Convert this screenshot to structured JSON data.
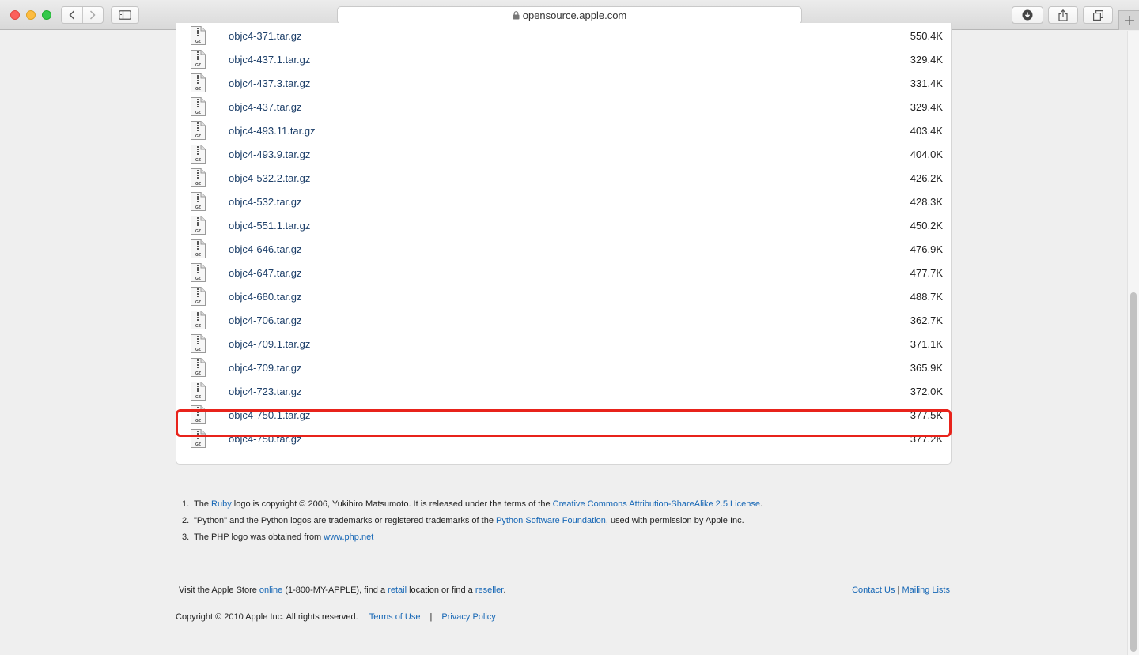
{
  "browser": {
    "url": "opensource.apple.com"
  },
  "files": [
    {
      "name": "objc4-371.tar.gz",
      "size": "550.4K"
    },
    {
      "name": "objc4-437.1.tar.gz",
      "size": "329.4K"
    },
    {
      "name": "objc4-437.3.tar.gz",
      "size": "331.4K"
    },
    {
      "name": "objc4-437.tar.gz",
      "size": "329.4K"
    },
    {
      "name": "objc4-493.11.tar.gz",
      "size": "403.4K"
    },
    {
      "name": "objc4-493.9.tar.gz",
      "size": "404.0K"
    },
    {
      "name": "objc4-532.2.tar.gz",
      "size": "426.2K"
    },
    {
      "name": "objc4-532.tar.gz",
      "size": "428.3K"
    },
    {
      "name": "objc4-551.1.tar.gz",
      "size": "450.2K"
    },
    {
      "name": "objc4-646.tar.gz",
      "size": "476.9K"
    },
    {
      "name": "objc4-647.tar.gz",
      "size": "477.7K"
    },
    {
      "name": "objc4-680.tar.gz",
      "size": "488.7K"
    },
    {
      "name": "objc4-706.tar.gz",
      "size": "362.7K"
    },
    {
      "name": "objc4-709.1.tar.gz",
      "size": "371.1K"
    },
    {
      "name": "objc4-709.tar.gz",
      "size": "365.9K"
    },
    {
      "name": "objc4-723.tar.gz",
      "size": "372.0K"
    },
    {
      "name": "objc4-750.1.tar.gz",
      "size": "377.5K"
    },
    {
      "name": "objc4-750.tar.gz",
      "size": "377.2K"
    }
  ],
  "file_icon_label": "GZ",
  "footnotes": {
    "n1": "1.",
    "n2": "2.",
    "n3": "3.",
    "f1_a": "The ",
    "f1_link1": "Ruby",
    "f1_b": " logo is copyright © 2006, Yukihiro Matsumoto. It is released under the terms of the ",
    "f1_link2": "Creative Commons Attribution-ShareAlike 2.5 License",
    "f1_c": ".",
    "f2_a": "\"Python\" and the Python logos are trademarks or registered trademarks of the ",
    "f2_link": "Python Software Foundation",
    "f2_b": ", used with permission by Apple Inc.",
    "f3_a": "The PHP logo was obtained from ",
    "f3_link": "www.php.net"
  },
  "footer": {
    "store_a": "Visit the Apple Store ",
    "store_online": "online",
    "store_b": " (1-800-MY-APPLE), find a ",
    "store_retail": "retail",
    "store_c": " location or find a ",
    "store_reseller": "reseller",
    "store_d": ".",
    "contact_us": "Contact Us",
    "contact_sep": " | ",
    "mailing_lists": "Mailing Lists",
    "copyright": "Copyright © 2010 Apple Inc. All rights reserved.",
    "terms": "Terms of Use",
    "bar": "|",
    "privacy": "Privacy Policy"
  },
  "highlighted_file": "objc4-750.1.tar.gz",
  "colors": {
    "highlight": "#e8231b",
    "link": "#1566b5",
    "file_link": "#1d3f69"
  }
}
